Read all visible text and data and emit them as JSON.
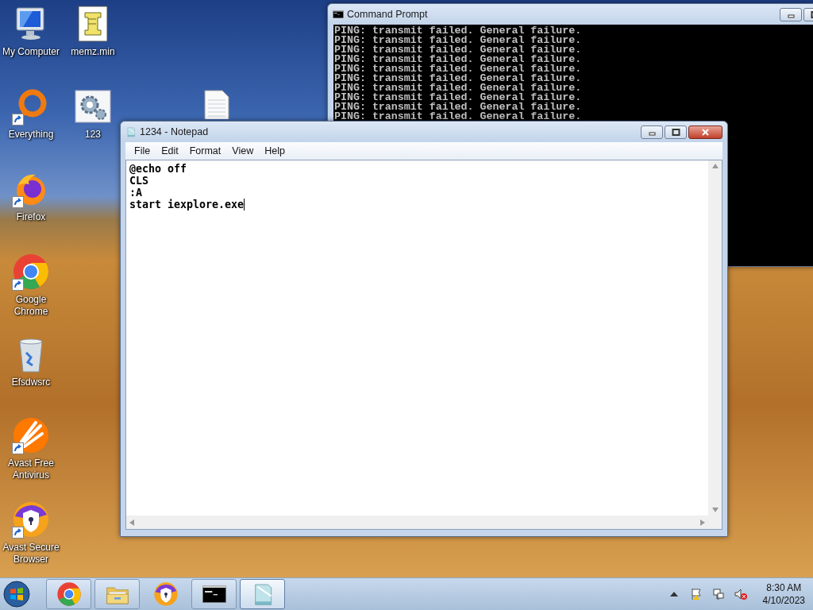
{
  "desktop_icons": [
    {
      "kind": "computer",
      "label": "My Computer",
      "shortcut": false
    },
    {
      "kind": "script",
      "label": "memz.min",
      "shortcut": false
    },
    {
      "kind": "ring",
      "label": "Everything",
      "shortcut": true
    },
    {
      "kind": "gears",
      "label": "123",
      "shortcut": false
    },
    {
      "kind": "document",
      "shortcut": false
    },
    {
      "kind": "firefox",
      "label": "Firefox",
      "shortcut": true
    },
    {
      "kind": "chrome",
      "label": "Google Chrome",
      "shortcut": true
    },
    {
      "kind": "bin",
      "label": "Efsdwsrc",
      "shortcut": false
    },
    {
      "kind": "avast",
      "label": "Avast Free Antivirus",
      "shortcut": true
    },
    {
      "kind": "secure",
      "label": "Avast Secure Browser",
      "shortcut": true
    }
  ],
  "cmd_window": {
    "title": "Command Prompt",
    "lines": [
      "PING: transmit failed. General failure.",
      "PING: transmit failed. General failure.",
      "PING: transmit failed. General failure.",
      "PING: transmit failed. General failure.",
      "PING: transmit failed. General failure.",
      "PING: transmit failed. General failure.",
      "PING: transmit failed. General failure.",
      "PING: transmit failed. General failure.",
      "PING: transmit failed. General failure.",
      "PING: transmit failed. General failure."
    ]
  },
  "notepad_window": {
    "title": "1234 - Notepad",
    "menu": [
      "File",
      "Edit",
      "Format",
      "View",
      "Help"
    ],
    "lines": [
      "@echo off",
      "CLS",
      ":A",
      "start iexplore.exe"
    ]
  },
  "taskbar": {
    "buttons": [
      {
        "kind": "chrome",
        "running": true,
        "selected": false
      },
      {
        "kind": "folder",
        "running": true,
        "selected": false
      },
      {
        "kind": "secure",
        "running": false,
        "selected": false
      },
      {
        "kind": "cmd",
        "running": true,
        "selected": false
      },
      {
        "kind": "notepad",
        "running": true,
        "selected": true
      }
    ],
    "clock": {
      "time": "8:30 AM",
      "date": "4/10/2023"
    }
  }
}
